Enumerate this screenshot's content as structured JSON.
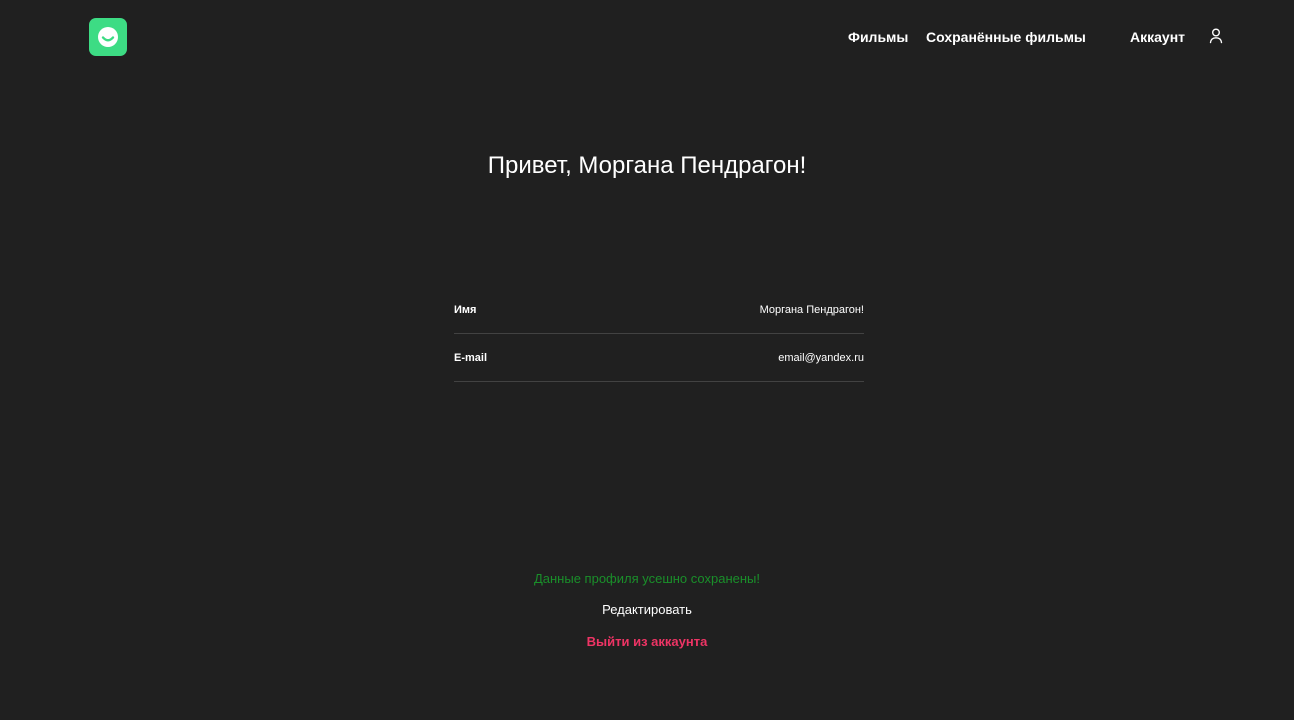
{
  "header": {
    "nav": {
      "movies": "Фильмы",
      "saved_movies": "Сохранённые фильмы",
      "account": "Аккаунт"
    },
    "logo_icon": "smile-logo-icon",
    "account_icon": "user-icon"
  },
  "profile": {
    "greeting": "Привет, Моргана Пендрагон!",
    "fields": [
      {
        "label": "Имя",
        "value": "Моргана Пендрагон!"
      },
      {
        "label": "E-mail",
        "value": "email@yandex.ru"
      }
    ],
    "success_message": "Данные профиля усешно сохранены!",
    "edit_label": "Редактировать",
    "logout_label": "Выйти из аккаунта"
  },
  "colors": {
    "background": "#202020",
    "logo": "#3ddc84",
    "success": "#1a8f2a",
    "logout": "#ee3465",
    "divider": "#424242"
  }
}
